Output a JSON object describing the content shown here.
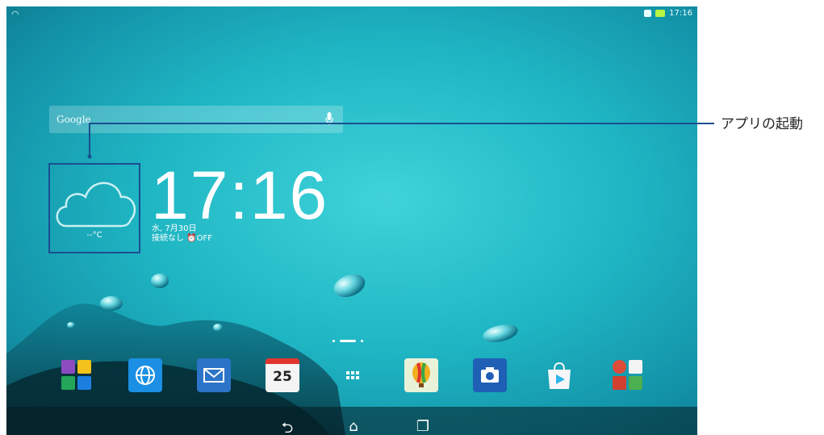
{
  "status_bar": {
    "time": "17:16",
    "icons": [
      "wifi-icon",
      "sim-icon",
      "battery-icon"
    ]
  },
  "search_widget": {
    "label": "Google",
    "icon": "mic-icon"
  },
  "weather_widget": {
    "temperature": "--°C",
    "icon": "cloud-icon"
  },
  "clock_widget": {
    "time": "17:16",
    "date": "水, 7月30日",
    "network": "接続なし",
    "alarm": "OFF"
  },
  "page_indicator": {
    "pages": 3,
    "current": 2
  },
  "dock": [
    {
      "name": "folder-icon"
    },
    {
      "name": "browser-icon"
    },
    {
      "name": "email-icon"
    },
    {
      "name": "calendar-icon",
      "label": "25"
    },
    {
      "name": "all-apps-icon"
    },
    {
      "name": "balloon-icon"
    },
    {
      "name": "camera-icon"
    },
    {
      "name": "play-store-icon"
    },
    {
      "name": "google-folder-icon"
    }
  ],
  "navigation": [
    "back-icon",
    "home-icon",
    "recents-icon"
  ],
  "callout": {
    "text": "アプリの起動"
  },
  "colors": {
    "callout_line": "#1b4f90",
    "wallpaper": "#1fb6c4"
  }
}
